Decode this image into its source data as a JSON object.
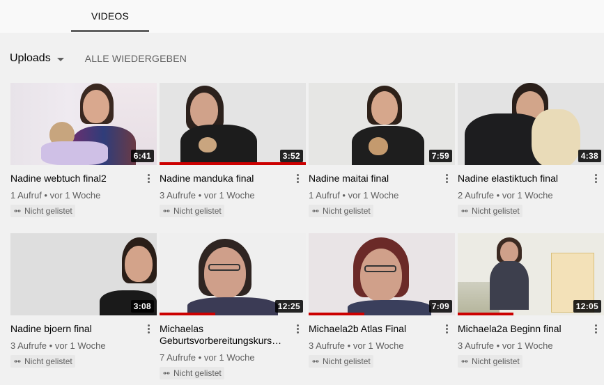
{
  "tabs": {
    "videos": "VIDEOS"
  },
  "toolbar": {
    "uploads": "Uploads",
    "play_all": "ALLE WIEDERGEBEN"
  },
  "colors": {
    "progress": "#cc0000",
    "background": "#f1f1f1"
  },
  "videos": [
    {
      "title": "Nadine webtuch final2",
      "duration": "6:41",
      "views": "1 Aufruf",
      "age": "vor 1 Woche",
      "badge": "Nicht gelistet",
      "watched_fraction": 0
    },
    {
      "title": "Nadine manduka final",
      "duration": "3:52",
      "views": "3 Aufrufe",
      "age": "vor 1 Woche",
      "badge": "Nicht gelistet",
      "watched_fraction": 1.0
    },
    {
      "title": "Nadine maitai final",
      "duration": "7:59",
      "views": "1 Aufruf",
      "age": "vor 1 Woche",
      "badge": "Nicht gelistet",
      "watched_fraction": 0
    },
    {
      "title": "Nadine elastiktuch final",
      "duration": "4:38",
      "views": "2 Aufrufe",
      "age": "vor 1 Woche",
      "badge": "Nicht gelistet",
      "watched_fraction": 0
    },
    {
      "title": "Nadine bjoern final",
      "duration": "3:08",
      "views": "3 Aufrufe",
      "age": "vor 1 Woche",
      "badge": "Nicht gelistet",
      "watched_fraction": 0
    },
    {
      "title": "Michaelas Geburtsvorbereitungskurs…",
      "duration": "12:25",
      "views": "7 Aufrufe",
      "age": "vor 1 Woche",
      "badge": "Nicht gelistet",
      "watched_fraction": 0.38
    },
    {
      "title": "Michaela2b Atlas Final",
      "duration": "7:09",
      "views": "3 Aufrufe",
      "age": "vor 1 Woche",
      "badge": "Nicht gelistet",
      "watched_fraction": 0.38
    },
    {
      "title": "Michaela2a Beginn final",
      "duration": "12:05",
      "views": "3 Aufrufe",
      "age": "vor 1 Woche",
      "badge": "Nicht gelistet",
      "watched_fraction": 0.38
    }
  ]
}
